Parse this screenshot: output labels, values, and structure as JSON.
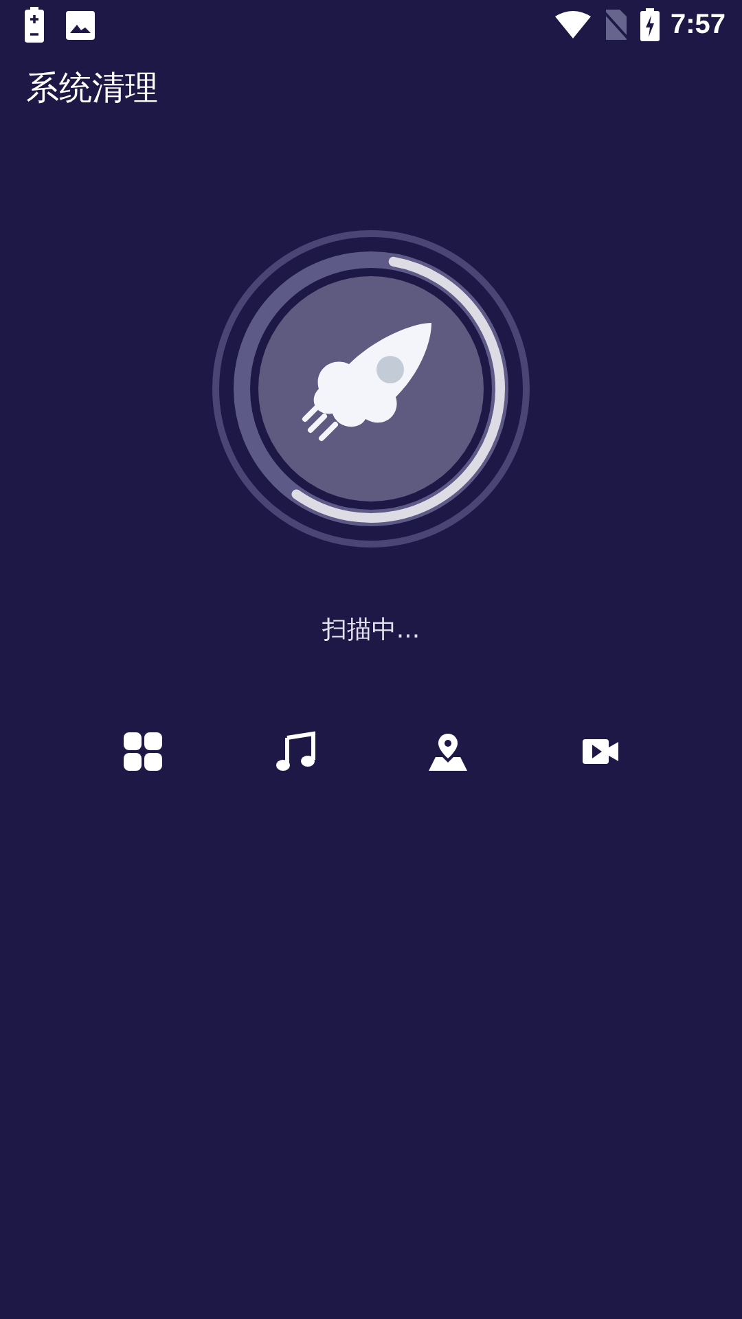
{
  "status_bar": {
    "time": "7:57"
  },
  "app_bar": {
    "title": "系统清理"
  },
  "scan": {
    "level": 0.57,
    "status": "扫描中..."
  },
  "categories": [
    {
      "kind": "apps"
    },
    {
      "kind": "music"
    },
    {
      "kind": "map"
    },
    {
      "kind": "video"
    }
  ]
}
